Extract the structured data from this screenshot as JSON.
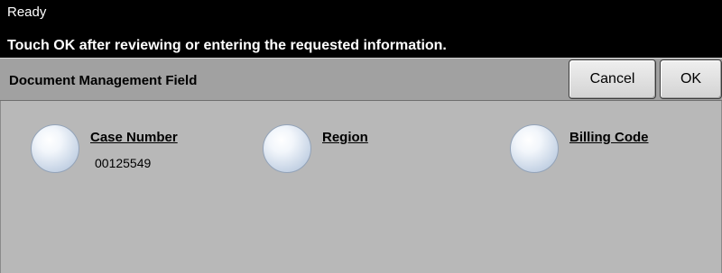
{
  "status": {
    "text": "Ready",
    "message": "Touch OK after reviewing or entering the requested information."
  },
  "header": {
    "title": "Document Management Field",
    "cancel_label": "Cancel",
    "ok_label": "OK"
  },
  "fields": [
    {
      "label": "Case Number",
      "value": "00125549"
    },
    {
      "label": "Region",
      "value": ""
    },
    {
      "label": "Billing Code",
      "value": ""
    }
  ]
}
